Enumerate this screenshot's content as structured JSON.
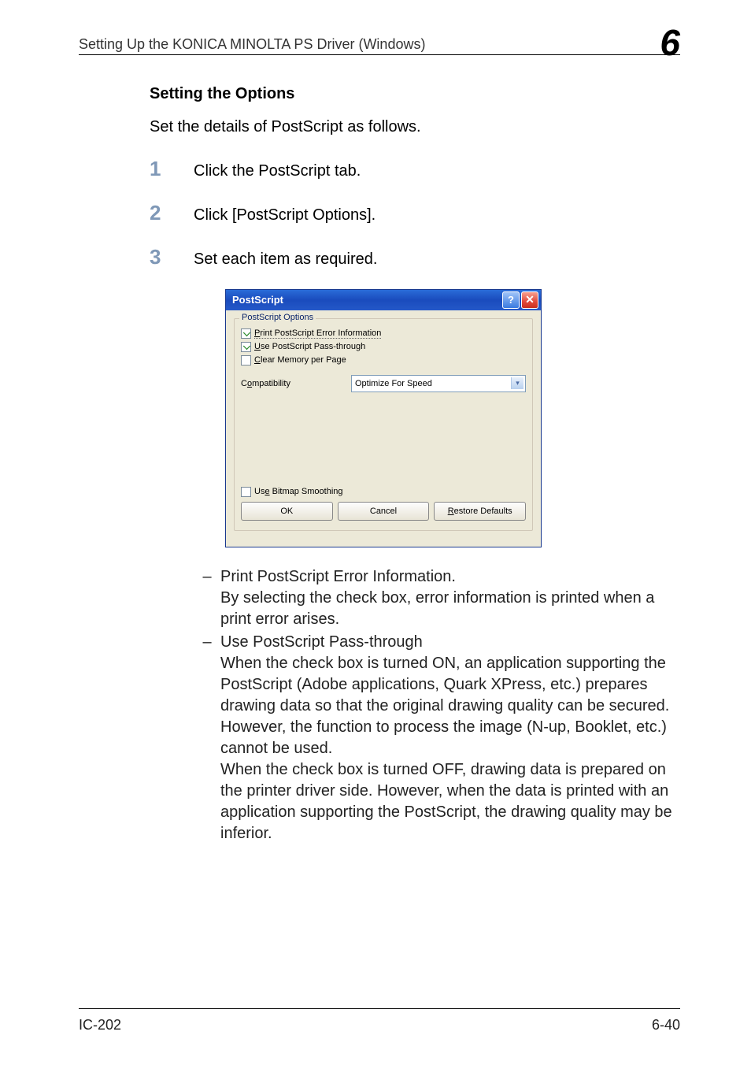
{
  "header": {
    "title": "Setting Up the KONICA MINOLTA PS Driver (Windows)",
    "chapter": "6"
  },
  "section_heading": "Setting the Options",
  "intro": "Set the details of PostScript as follows.",
  "steps": {
    "s1": "Click the PostScript tab.",
    "s2": "Click [PostScript Options].",
    "s3": "Set each item as required."
  },
  "dialog": {
    "title": "PostScript",
    "help_glyph": "?",
    "close_glyph": "✕",
    "group_title": "PostScript Options",
    "chk_print_error_pre": "P",
    "chk_print_error_rest": "rint PostScript Error Information",
    "chk_pass_pre": "U",
    "chk_pass_rest": "se PostScript Pass-through",
    "chk_clear_pre": "C",
    "chk_clear_rest": "lear Memory per Page",
    "compat_label_pre": "C",
    "compat_label_mid": "o",
    "compat_label_rest": "mpatibility",
    "compat_value": "Optimize For Speed",
    "chk_bitmap_pre": "Us",
    "chk_bitmap_key": "e",
    "chk_bitmap_rest": " Bitmap Smoothing",
    "btn_ok": "OK",
    "btn_cancel": "Cancel",
    "btn_restore_pre": "R",
    "btn_restore_rest": "estore Defaults"
  },
  "bullets": {
    "b1_title": "Print PostScript Error Information.",
    "b1_body": "By selecting the check box, error information is printed when a print error arises.",
    "b2_title": "Use PostScript Pass-through",
    "b2_body": "When the check box is turned ON, an application supporting the PostScript (Adobe applications, Quark XPress, etc.) prepares drawing data so that the original drawing quality can be secured. However, the function to process the image (N-up, Booklet, etc.) cannot be used.\nWhen the check box is turned OFF, drawing data is prepared on the printer driver side. However, when the data is printed with an application supporting the PostScript, the drawing quality may be inferior."
  },
  "footer": {
    "left": "IC-202",
    "right": "6-40"
  }
}
